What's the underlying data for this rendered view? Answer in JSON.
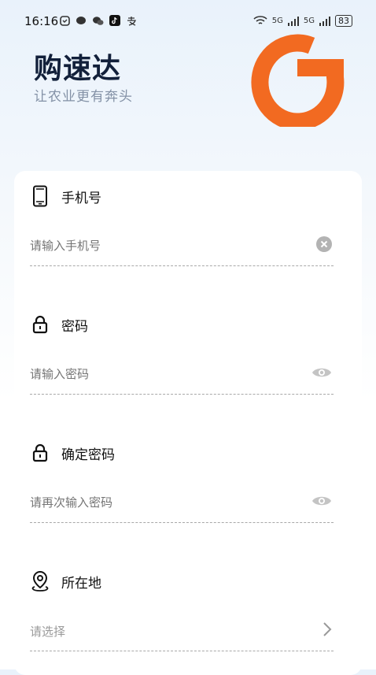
{
  "status_bar": {
    "time": "16:16",
    "left_icons": [
      "shield-app-icon",
      "chat-bubble-icon",
      "wechat-icon",
      "tiktok-icon",
      "alipay-icon"
    ],
    "signal_labels": [
      "5G",
      "5G"
    ],
    "battery": "83"
  },
  "brand": {
    "title": "购速达",
    "subtitle": "让农业更有奔头",
    "logo_color": "#f26a21"
  },
  "form": {
    "phone": {
      "label": "手机号",
      "placeholder": "请输入手机号",
      "icon": "phone-icon",
      "action_icon": "clear-icon"
    },
    "password": {
      "label": "密码",
      "placeholder": "请输入密码",
      "icon": "lock-icon",
      "action_icon": "eye-icon"
    },
    "confirm_password": {
      "label": "确定密码",
      "placeholder": "请再次输入密码",
      "icon": "lock-icon",
      "action_icon": "eye-icon"
    },
    "location": {
      "label": "所在地",
      "placeholder": "请选择",
      "icon": "location-pin-icon",
      "action_icon": "chevron-right-icon"
    }
  }
}
